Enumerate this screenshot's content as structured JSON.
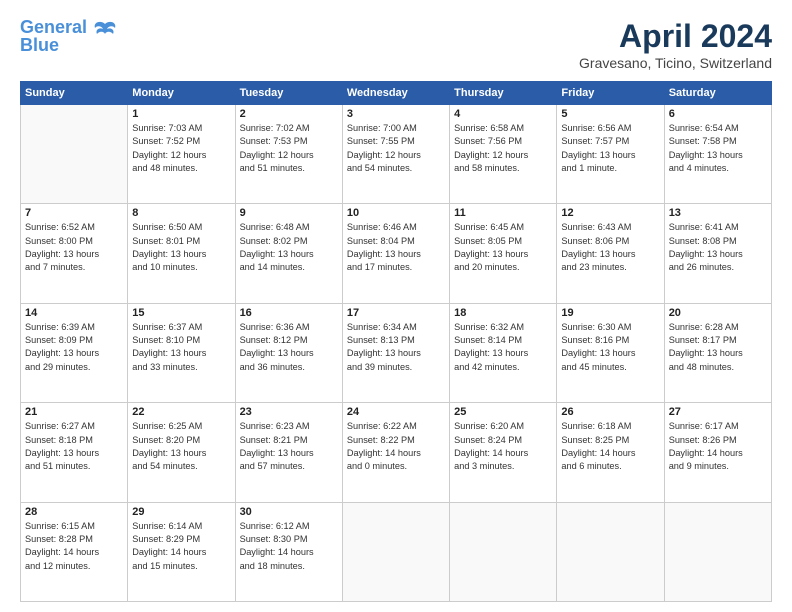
{
  "logo": {
    "line1": "General",
    "line2": "Blue"
  },
  "title": "April 2024",
  "subtitle": "Gravesano, Ticino, Switzerland",
  "days_header": [
    "Sunday",
    "Monday",
    "Tuesday",
    "Wednesday",
    "Thursday",
    "Friday",
    "Saturday"
  ],
  "weeks": [
    [
      {
        "day": "",
        "info": ""
      },
      {
        "day": "1",
        "info": "Sunrise: 7:03 AM\nSunset: 7:52 PM\nDaylight: 12 hours\nand 48 minutes."
      },
      {
        "day": "2",
        "info": "Sunrise: 7:02 AM\nSunset: 7:53 PM\nDaylight: 12 hours\nand 51 minutes."
      },
      {
        "day": "3",
        "info": "Sunrise: 7:00 AM\nSunset: 7:55 PM\nDaylight: 12 hours\nand 54 minutes."
      },
      {
        "day": "4",
        "info": "Sunrise: 6:58 AM\nSunset: 7:56 PM\nDaylight: 12 hours\nand 58 minutes."
      },
      {
        "day": "5",
        "info": "Sunrise: 6:56 AM\nSunset: 7:57 PM\nDaylight: 13 hours\nand 1 minute."
      },
      {
        "day": "6",
        "info": "Sunrise: 6:54 AM\nSunset: 7:58 PM\nDaylight: 13 hours\nand 4 minutes."
      }
    ],
    [
      {
        "day": "7",
        "info": "Sunrise: 6:52 AM\nSunset: 8:00 PM\nDaylight: 13 hours\nand 7 minutes."
      },
      {
        "day": "8",
        "info": "Sunrise: 6:50 AM\nSunset: 8:01 PM\nDaylight: 13 hours\nand 10 minutes."
      },
      {
        "day": "9",
        "info": "Sunrise: 6:48 AM\nSunset: 8:02 PM\nDaylight: 13 hours\nand 14 minutes."
      },
      {
        "day": "10",
        "info": "Sunrise: 6:46 AM\nSunset: 8:04 PM\nDaylight: 13 hours\nand 17 minutes."
      },
      {
        "day": "11",
        "info": "Sunrise: 6:45 AM\nSunset: 8:05 PM\nDaylight: 13 hours\nand 20 minutes."
      },
      {
        "day": "12",
        "info": "Sunrise: 6:43 AM\nSunset: 8:06 PM\nDaylight: 13 hours\nand 23 minutes."
      },
      {
        "day": "13",
        "info": "Sunrise: 6:41 AM\nSunset: 8:08 PM\nDaylight: 13 hours\nand 26 minutes."
      }
    ],
    [
      {
        "day": "14",
        "info": "Sunrise: 6:39 AM\nSunset: 8:09 PM\nDaylight: 13 hours\nand 29 minutes."
      },
      {
        "day": "15",
        "info": "Sunrise: 6:37 AM\nSunset: 8:10 PM\nDaylight: 13 hours\nand 33 minutes."
      },
      {
        "day": "16",
        "info": "Sunrise: 6:36 AM\nSunset: 8:12 PM\nDaylight: 13 hours\nand 36 minutes."
      },
      {
        "day": "17",
        "info": "Sunrise: 6:34 AM\nSunset: 8:13 PM\nDaylight: 13 hours\nand 39 minutes."
      },
      {
        "day": "18",
        "info": "Sunrise: 6:32 AM\nSunset: 8:14 PM\nDaylight: 13 hours\nand 42 minutes."
      },
      {
        "day": "19",
        "info": "Sunrise: 6:30 AM\nSunset: 8:16 PM\nDaylight: 13 hours\nand 45 minutes."
      },
      {
        "day": "20",
        "info": "Sunrise: 6:28 AM\nSunset: 8:17 PM\nDaylight: 13 hours\nand 48 minutes."
      }
    ],
    [
      {
        "day": "21",
        "info": "Sunrise: 6:27 AM\nSunset: 8:18 PM\nDaylight: 13 hours\nand 51 minutes."
      },
      {
        "day": "22",
        "info": "Sunrise: 6:25 AM\nSunset: 8:20 PM\nDaylight: 13 hours\nand 54 minutes."
      },
      {
        "day": "23",
        "info": "Sunrise: 6:23 AM\nSunset: 8:21 PM\nDaylight: 13 hours\nand 57 minutes."
      },
      {
        "day": "24",
        "info": "Sunrise: 6:22 AM\nSunset: 8:22 PM\nDaylight: 14 hours\nand 0 minutes."
      },
      {
        "day": "25",
        "info": "Sunrise: 6:20 AM\nSunset: 8:24 PM\nDaylight: 14 hours\nand 3 minutes."
      },
      {
        "day": "26",
        "info": "Sunrise: 6:18 AM\nSunset: 8:25 PM\nDaylight: 14 hours\nand 6 minutes."
      },
      {
        "day": "27",
        "info": "Sunrise: 6:17 AM\nSunset: 8:26 PM\nDaylight: 14 hours\nand 9 minutes."
      }
    ],
    [
      {
        "day": "28",
        "info": "Sunrise: 6:15 AM\nSunset: 8:28 PM\nDaylight: 14 hours\nand 12 minutes."
      },
      {
        "day": "29",
        "info": "Sunrise: 6:14 AM\nSunset: 8:29 PM\nDaylight: 14 hours\nand 15 minutes."
      },
      {
        "day": "30",
        "info": "Sunrise: 6:12 AM\nSunset: 8:30 PM\nDaylight: 14 hours\nand 18 minutes."
      },
      {
        "day": "",
        "info": ""
      },
      {
        "day": "",
        "info": ""
      },
      {
        "day": "",
        "info": ""
      },
      {
        "day": "",
        "info": ""
      }
    ]
  ]
}
